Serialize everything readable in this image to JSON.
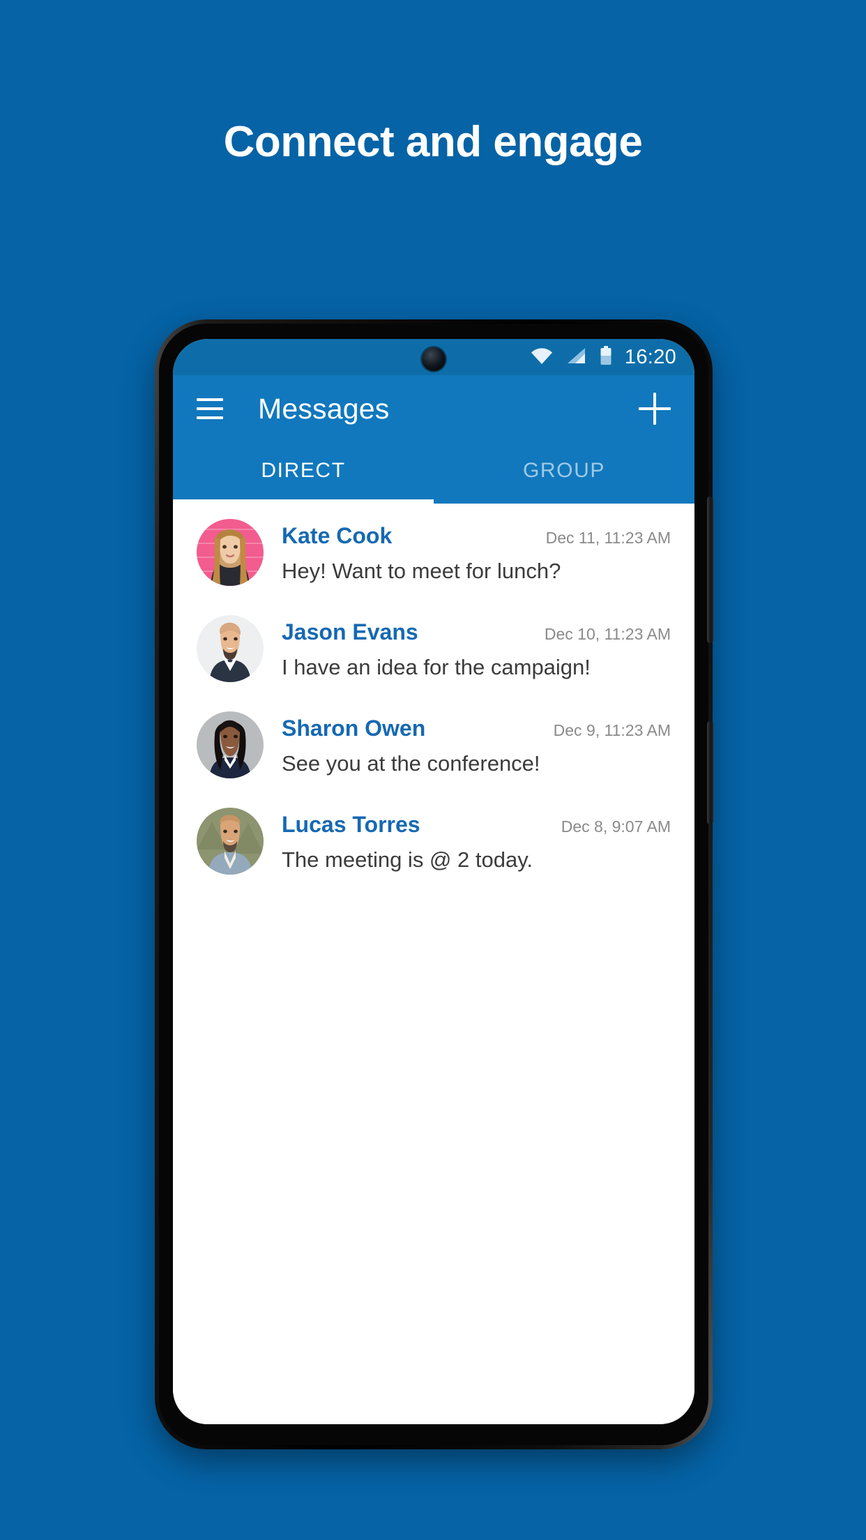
{
  "promo": {
    "headline": "Connect and engage",
    "background_color": "#0563A6"
  },
  "device": {
    "frame_color": "#000000",
    "buttons": [
      "volume-rocker",
      "power-button"
    ],
    "camera": "punch-hole-camera"
  },
  "status_bar": {
    "background_color": "#0E6DA9",
    "time": "16:20",
    "icons": [
      "wifi-icon",
      "cellular-signal-icon",
      "battery-icon"
    ]
  },
  "app_bar": {
    "background_color": "#1178BD",
    "menu_icon": "hamburger-menu-icon",
    "title": "Messages",
    "action_icon": "plus-icon"
  },
  "tabs": {
    "active_index": 0,
    "indicator_color": "#FFFFFF",
    "items": [
      {
        "label": "DIRECT",
        "active": true
      },
      {
        "label": "GROUP",
        "active": false
      }
    ]
  },
  "conversations": {
    "name_color": "#1669B2",
    "time_color": "#8A8A8A",
    "message_color": "#3C3C3C",
    "items": [
      {
        "name": "Kate Cook",
        "time": "Dec 11, 11:23 AM",
        "message": "Hey! Want to meet for lunch?",
        "avatar": "avatar-kate-cook"
      },
      {
        "name": "Jason Evans",
        "time": "Dec 10, 11:23 AM",
        "message": "I have an idea for the campaign!",
        "avatar": "avatar-jason-evans"
      },
      {
        "name": "Sharon Owen",
        "time": "Dec 9, 11:23 AM",
        "message": "See you at the conference!",
        "avatar": "avatar-sharon-owen"
      },
      {
        "name": "Lucas Torres",
        "time": "Dec 8, 9:07 AM",
        "message": "The meeting is @ 2 today.",
        "avatar": "avatar-lucas-torres"
      }
    ]
  }
}
